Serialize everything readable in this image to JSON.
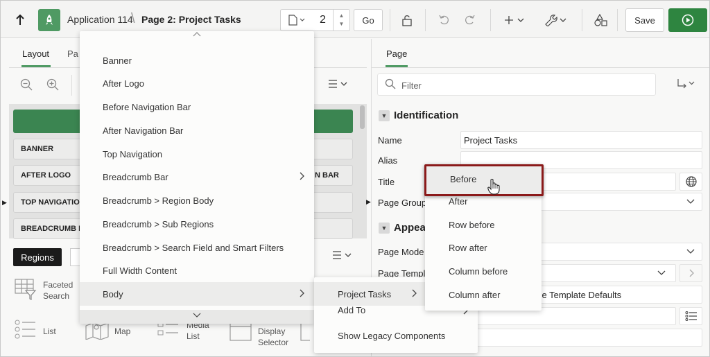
{
  "toolbar": {
    "app_name": "Application 114",
    "separator": "\\",
    "page_title": "Page 2: Project Tasks",
    "page_number": "2",
    "go_label": "Go",
    "save_label": "Save"
  },
  "left_pane": {
    "tab_layout": "Layout",
    "tab_page_partial": "Pa",
    "slots": {
      "banner": "BANNER",
      "after_logo": "AFTER LOGO",
      "top_navigation": "TOP NAVIGATION",
      "breadcrumb_bar": "BREADCRUMB BA",
      "nav_bar_partial": "N BAR"
    },
    "regions_label": "Regions",
    "components": {
      "faceted_search_1": "Faceted",
      "faceted_search_2": "Search",
      "list": "List",
      "map": "Map",
      "media_list_1": "Media",
      "media_list_2": "List",
      "display_selector_1": "Display",
      "display_selector_2": "Selector"
    }
  },
  "right_pane": {
    "tab_page": "Page",
    "filter_placeholder": "Filter",
    "identification": {
      "title": "Identification",
      "name_label": "Name",
      "name_value": "Project Tasks",
      "alias_label": "Alias",
      "title_label": "Title",
      "page_group_label": "Page Group"
    },
    "appearance": {
      "title_partial": "Appea",
      "page_mode_label": "Page Mode",
      "page_template_label": "Page Templa",
      "template_defaults_partial": "se Template Defaults"
    }
  },
  "context_menu": {
    "items": [
      "Banner",
      "After Logo",
      "Before Navigation Bar",
      "After Navigation Bar",
      "Top Navigation",
      "Breadcrumb Bar",
      "Breadcrumb > Region Body",
      "Breadcrumb > Sub Regions",
      "Breadcrumb > Search Field and Smart Filters",
      "Full Width Content",
      "Body"
    ]
  },
  "submenu": {
    "items": [
      "Project Tasks",
      "Add To",
      "Show Legacy Components"
    ]
  },
  "position_menu": {
    "items": [
      "Before",
      "After",
      "Row before",
      "Row after",
      "Column before",
      "Column after"
    ]
  },
  "colors": {
    "accent_green": "#4f9a63",
    "run_button": "#2e8540",
    "highlight_border": "#8b1a1a",
    "layout_bar": "#3b8551"
  }
}
